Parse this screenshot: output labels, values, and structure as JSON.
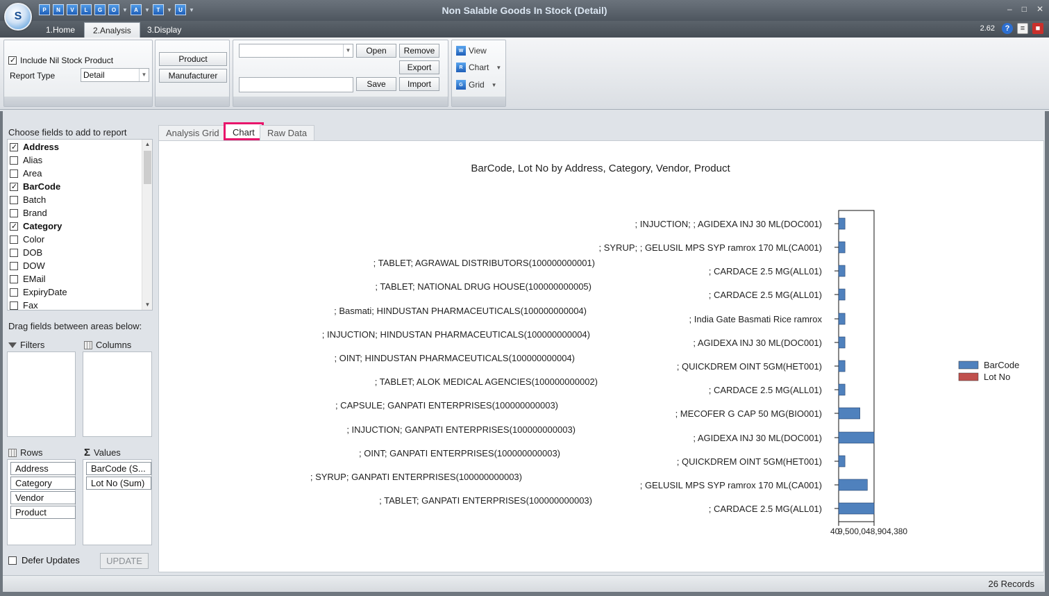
{
  "window": {
    "title": "Non Salable Goods In Stock (Detail)",
    "version": "2.62",
    "logo_letter": "S",
    "quick_access": [
      "P",
      "N",
      "V",
      "L",
      "G",
      "O",
      "A",
      "T",
      "U"
    ]
  },
  "ribbon_tabs": [
    "1.Home",
    "2.Analysis",
    "3.Display"
  ],
  "ribbon": {
    "include_nil_label": "Include Nil Stock Product",
    "include_nil_checked": true,
    "report_type_label": "Report Type",
    "report_type_value": "Detail",
    "product_btn": "Product",
    "manufacturer_btn": "Manufacturer",
    "layout_combo_value": "",
    "layout_name_value": "",
    "open_btn": "Open",
    "remove_btn": "Remove",
    "export_btn": "Export",
    "save_btn": "Save",
    "import_btn": "Import",
    "view_btn": "View",
    "chart_btn": "Chart",
    "grid_btn": "Grid"
  },
  "left": {
    "choose_label": "Choose fields to add to report",
    "fields": [
      {
        "label": "Address",
        "checked": true
      },
      {
        "label": "Alias",
        "checked": false
      },
      {
        "label": "Area",
        "checked": false
      },
      {
        "label": "BarCode",
        "checked": true
      },
      {
        "label": "Batch",
        "checked": false
      },
      {
        "label": "Brand",
        "checked": false
      },
      {
        "label": "Category",
        "checked": true
      },
      {
        "label": "Color",
        "checked": false
      },
      {
        "label": "DOB",
        "checked": false
      },
      {
        "label": "DOW",
        "checked": false
      },
      {
        "label": "EMail",
        "checked": false
      },
      {
        "label": "ExpiryDate",
        "checked": false
      },
      {
        "label": "Fax",
        "checked": false
      }
    ],
    "drag_label": "Drag fields between areas below:",
    "filters_label": "Filters",
    "columns_label": "Columns",
    "rows_label": "Rows",
    "values_label": "Values",
    "rows": [
      "Address",
      "Category",
      "Vendor",
      "Product"
    ],
    "values": [
      "BarCode (S...",
      "Lot No (Sum)"
    ],
    "defer_label": "Defer Updates",
    "update_btn": "UPDATE"
  },
  "content_tabs": [
    "Analysis Grid",
    "Chart",
    "Raw Data"
  ],
  "chart_data": {
    "type": "bar",
    "orientation": "horizontal",
    "title": "BarCode, Lot No by Address, Category, Vendor, Product",
    "x_tick_labels": [
      "40",
      "9,500,048,904,380"
    ],
    "categories": [
      {
        "group": "",
        "product": "; INJUCTION; ; AGIDEXA INJ 30 ML(DOC001)"
      },
      {
        "group": "",
        "product": "; SYRUP; ; GELUSIL MPS SYP ramrox 170 ML(CA001)"
      },
      {
        "group": "; TABLET; AGRAWAL DISTRIBUTORS(100000000001)",
        "product": "; CARDACE 2.5 MG(ALL01)"
      },
      {
        "group": "; TABLET; NATIONAL DRUG HOUSE(100000000005)",
        "product": "; CARDACE 2.5 MG(ALL01)"
      },
      {
        "group": "; Basmati; HINDUSTAN PHARMACEUTICALS(100000000004)",
        "product": "; India Gate Basmati Rice ramrox"
      },
      {
        "group": "; INJUCTION; HINDUSTAN PHARMACEUTICALS(100000000004)",
        "product": "; AGIDEXA INJ 30 ML(DOC001)"
      },
      {
        "group": "; OINT; HINDUSTAN PHARMACEUTICALS(100000000004)",
        "product": "; QUICKDREM OINT 5GM(HET001)"
      },
      {
        "group": "; TABLET; ALOK MEDICAL AGENCIES(100000000002)",
        "product": "; CARDACE 2.5 MG(ALL01)"
      },
      {
        "group": "; CAPSULE; GANPATI ENTERPRISES(100000000003)",
        "product": "; MECOFER G CAP 50 MG(BIO001)"
      },
      {
        "group": "; INJUCTION; GANPATI ENTERPRISES(100000000003)",
        "product": "; AGIDEXA INJ 30 ML(DOC001)"
      },
      {
        "group": "; OINT; GANPATI ENTERPRISES(100000000003)",
        "product": "; QUICKDREM OINT 5GM(HET001)"
      },
      {
        "group": "; SYRUP; GANPATI ENTERPRISES(100000000003)",
        "product": "; GELUSIL MPS SYP ramrox 170 ML(CA001)"
      },
      {
        "group": "; TABLET; GANPATI ENTERPRISES(100000000003)",
        "product": "; CARDACE 2.5 MG(ALL01)"
      }
    ],
    "series": [
      {
        "name": "BarCode",
        "color": "#4f81bd",
        "values": [
          1700000000000,
          1700000000000,
          1700000000000,
          1700000000000,
          1700000000000,
          1700000000000,
          1700000000000,
          1700000000000,
          5700000000000,
          9500048904380,
          1700000000000,
          7700000000000,
          9500048904380
        ]
      },
      {
        "name": "Lot No",
        "color": "#c0504d",
        "values": [
          0,
          0,
          0,
          0,
          0,
          0,
          0,
          0,
          0,
          0,
          0,
          0,
          0
        ]
      }
    ],
    "xlim": [
      40,
      9500048904380
    ],
    "legend_position": "right"
  },
  "status": {
    "records": "26 Records"
  }
}
